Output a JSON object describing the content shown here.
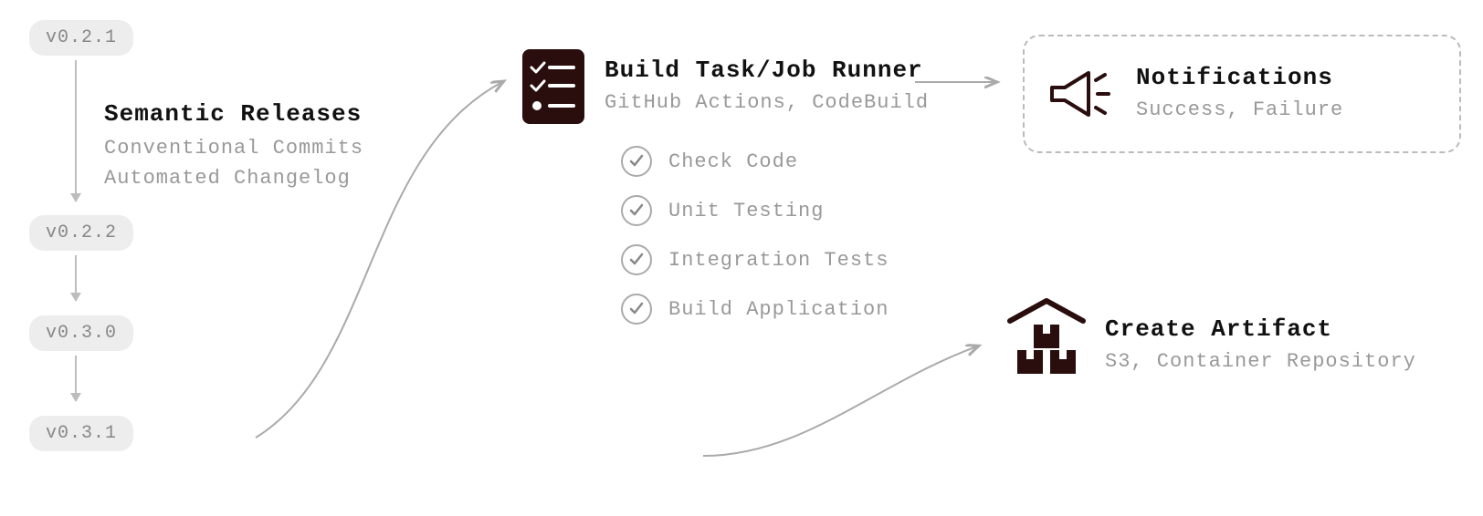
{
  "versions": [
    "v0.2.1",
    "v0.2.2",
    "v0.3.0",
    "v0.3.1"
  ],
  "semantic": {
    "title": "Semantic Releases",
    "line1": "Conventional Commits",
    "line2": "Automated Changelog"
  },
  "runner": {
    "title": "Build Task/Job Runner",
    "sub": "GitHub Actions, CodeBuild"
  },
  "checks": [
    "Check Code",
    "Unit Testing",
    "Integration Tests",
    "Build Application"
  ],
  "notifications": {
    "title": "Notifications",
    "sub": "Success, Failure"
  },
  "artifact": {
    "title": "Create Artifact",
    "sub": "S3, Container Repository"
  }
}
